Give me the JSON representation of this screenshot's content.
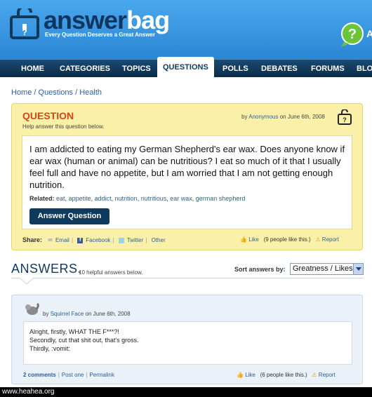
{
  "brand": {
    "name_dark": "answer",
    "name_light": "bag",
    "tagline": "Every Question Deserves a Great Answer",
    "help_partial": "A"
  },
  "nav": [
    "HOME",
    "CATEGORIES",
    "TOPICS",
    "QUESTIONS",
    "POLLS",
    "DEBATES",
    "FORUMS",
    "BLO"
  ],
  "nav_active": "QUESTIONS",
  "breadcrumb": "Home / Questions / Health",
  "question": {
    "label": "QUESTION",
    "sublabel": "Help answer this question below.",
    "by_prefix": "by",
    "author": "Anonymous",
    "date": "on June 6th, 2008",
    "text": "I am addicted to eating my German Shepherd's ear wax. Does anyone know if ear wax (human or animal) can be nutritious? I eat so much of it that I usually feel full and have no appetite, but I am worried that I am not getting enough nutrition.",
    "related_label": "Related:",
    "related_tags": [
      "eat",
      "appetite",
      "addict",
      "nutrition",
      "nutritious",
      "ear wax",
      "german shepherd"
    ],
    "answer_button": "Answer Question",
    "share_label": "Share:",
    "share_links": [
      "Email",
      "Facebook",
      "Twitter",
      "Other"
    ],
    "like_label": "Like",
    "like_count": "(9 people like this.)",
    "report": "Report"
  },
  "answers": {
    "title": "ANSWERS.",
    "count_text": "10 helpful answers below.",
    "sort_label": "Sort answers by:",
    "sort_value": "Greatness / Likes"
  },
  "answer1": {
    "by_prefix": "by",
    "author": "Squirrel Face",
    "date": "on June 6th, 2008",
    "lines": [
      "Alright, firstly, WHAT THE F***?!",
      "Secondly, cut that shit out, that's gross.",
      "Thirdly, :vomit:"
    ],
    "comments": "2 comments",
    "post_one": "Post one",
    "permalink": "Permalink",
    "like_label": "Like",
    "like_count": "(6 people like this.)",
    "report": "Report"
  },
  "footer": "www.heahea.org",
  "colors": {
    "header_blue": "#2d8ad6",
    "nav_navy": "#0f3a5e",
    "question_yellow": "#fbf0a8",
    "question_red": "#d4451a",
    "link": "#2a5fa0"
  }
}
